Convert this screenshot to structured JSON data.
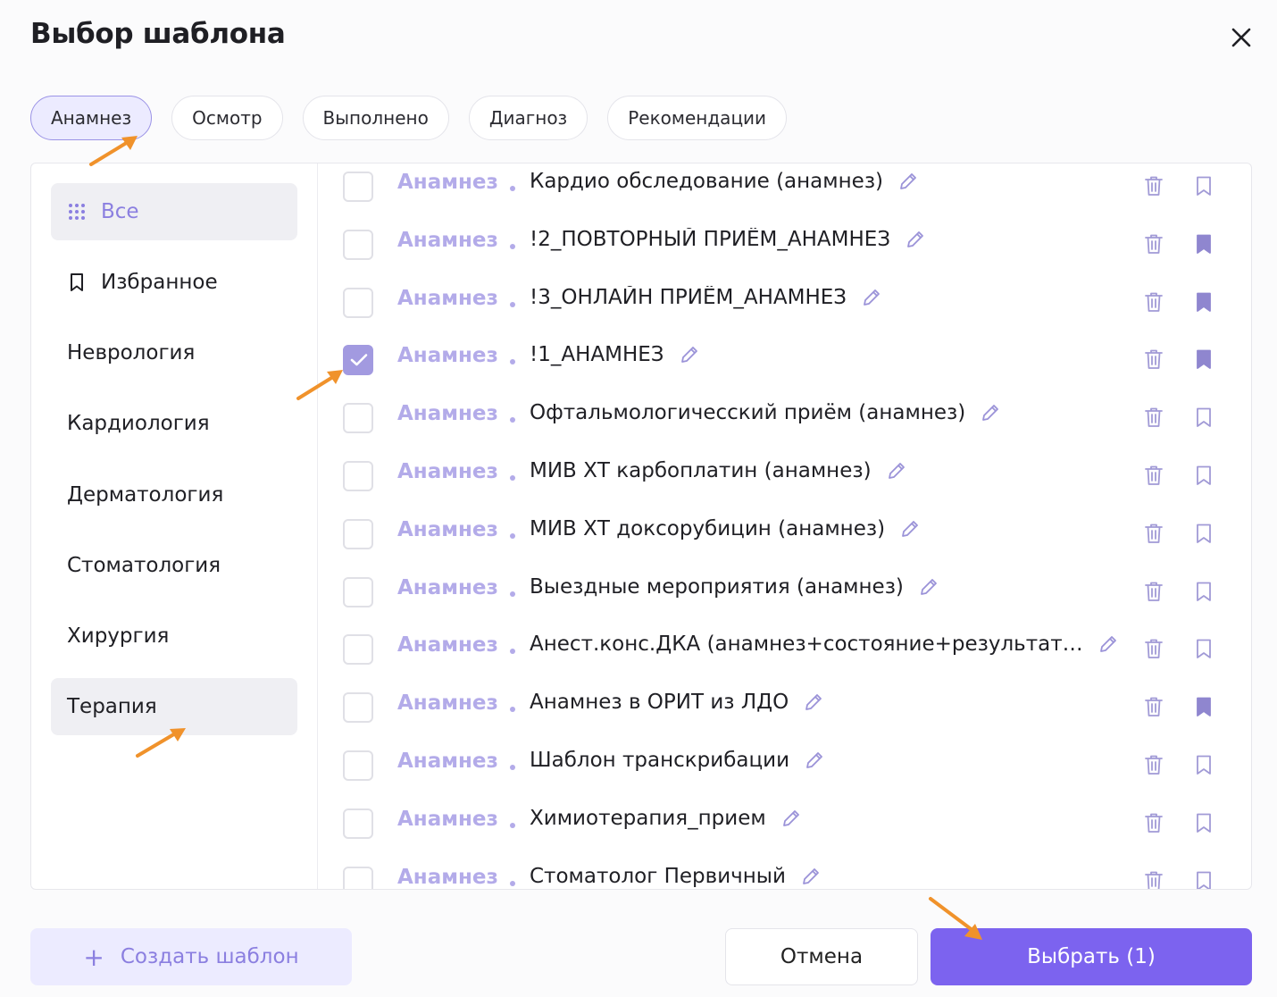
{
  "dialog": {
    "title": "Выбор шаблона"
  },
  "tabs": [
    {
      "label": "Анамнез",
      "active": true
    },
    {
      "label": "Осмотр",
      "active": false
    },
    {
      "label": "Выполнено",
      "active": false
    },
    {
      "label": "Диагноз",
      "active": false
    },
    {
      "label": "Рекомендации",
      "active": false
    }
  ],
  "sidebar": {
    "items": [
      {
        "label": "Все",
        "icon": "grid-dots-icon",
        "selected": true
      },
      {
        "label": "Избранное",
        "icon": "bookmark-icon",
        "selected": false
      },
      {
        "label": "Неврология",
        "selected": false
      },
      {
        "label": "Кардиология",
        "selected": false
      },
      {
        "label": "Дерматология",
        "selected": false
      },
      {
        "label": "Стоматология",
        "selected": false
      },
      {
        "label": "Хирургия",
        "selected": false
      },
      {
        "label": "Терапия",
        "selected": false,
        "hovered": true
      }
    ]
  },
  "templates": [
    {
      "category": "Анамнез",
      "name": "Кардио обследование (анамнез)",
      "checked": false,
      "favorite": false
    },
    {
      "category": "Анамнез",
      "name": "!2_ПОВТОРНЫЙ ПРИЁМ_АНАМНЕЗ",
      "checked": false,
      "favorite": true
    },
    {
      "category": "Анамнез",
      "name": "!3_ОНЛАЙН ПРИЁМ_АНАМНЕЗ",
      "checked": false,
      "favorite": true
    },
    {
      "category": "Анамнез",
      "name": "!1_АНАМНЕЗ",
      "checked": true,
      "favorite": true
    },
    {
      "category": "Анамнез",
      "name": "Офтальмологичесский приём (анамнез)",
      "checked": false,
      "favorite": false
    },
    {
      "category": "Анамнез",
      "name": "МИВ ХТ карбоплатин (анамнез)",
      "checked": false,
      "favorite": false
    },
    {
      "category": "Анамнез",
      "name": "МИВ ХТ доксорубицин (анамнез)",
      "checked": false,
      "favorite": false
    },
    {
      "category": "Анамнез",
      "name": "Выездные мероприятия (анамнез)",
      "checked": false,
      "favorite": false
    },
    {
      "category": "Анамнез",
      "name": "Анест.конс.ДКА (анамнез+состояние+результат…",
      "checked": false,
      "favorite": false
    },
    {
      "category": "Анамнез",
      "name": "Анамнез в ОРИТ из ЛДО",
      "checked": false,
      "favorite": true
    },
    {
      "category": "Анамнез",
      "name": "Шаблон транскрибации",
      "checked": false,
      "favorite": false
    },
    {
      "category": "Анамнез",
      "name": "Химиотерапия_прием",
      "checked": false,
      "favorite": false
    },
    {
      "category": "Анамнез",
      "name": "Стоматолог Первичный",
      "checked": false,
      "favorite": false
    }
  ],
  "footer": {
    "create_label": "Создать шаблон",
    "cancel_label": "Отмена",
    "select_label": "Выбрать (1)"
  },
  "colors": {
    "accent": "#7c63ef",
    "accent_light": "#ecebff",
    "tag": "#b3abe9",
    "annotation_arrow": "#f0922b"
  }
}
